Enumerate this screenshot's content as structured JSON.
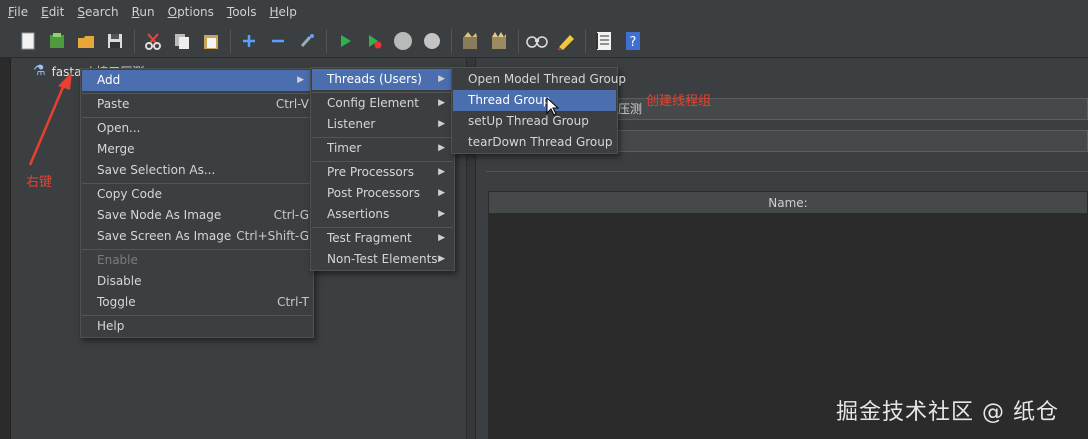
{
  "menubar": [
    "File",
    "Edit",
    "Search",
    "Run",
    "Options",
    "Tools",
    "Help"
  ],
  "toolbar_icons": [
    "new-icon",
    "templates-icon",
    "open-icon",
    "save-icon",
    "cut-icon",
    "copy-icon",
    "paste-icon",
    "expand-icon",
    "collapse-icon",
    "toggle-icon",
    "start-icon",
    "start-no-pause-icon",
    "stop-icon",
    "shutdown-icon",
    "clear-icon",
    "clear-all-icon",
    "search-icon",
    "reset-search-icon",
    "function-helper-icon",
    "help-icon"
  ],
  "tree": {
    "root_label": "fastapi 接口压测"
  },
  "right_panel": {
    "name_value": "压测",
    "table_header": "Name:"
  },
  "context_menu": {
    "items": [
      {
        "label": "Add",
        "shortcut": "",
        "submenu": true,
        "selected": true
      },
      {
        "label": "Paste",
        "shortcut": "Ctrl-V"
      },
      {
        "label": "Open..."
      },
      {
        "label": "Merge"
      },
      {
        "label": "Save Selection As..."
      },
      {
        "label": "Copy Code"
      },
      {
        "label": "Save Node As Image",
        "shortcut": "Ctrl-G"
      },
      {
        "label": "Save Screen As Image",
        "shortcut": "Ctrl+Shift-G"
      },
      {
        "label": "Enable",
        "disabled": true
      },
      {
        "label": "Disable"
      },
      {
        "label": "Toggle",
        "shortcut": "Ctrl-T"
      },
      {
        "label": "Help"
      }
    ]
  },
  "add_menu": {
    "items": [
      "Threads (Users)",
      "Config Element",
      "Listener",
      "Timer",
      "Pre Processors",
      "Post Processors",
      "Assertions",
      "Test Fragment",
      "Non-Test Elements"
    ]
  },
  "threads_menu": {
    "items": [
      "Open Model Thread Group",
      "Thread Group",
      "setUp Thread Group",
      "tearDown Thread Group"
    ]
  },
  "annotations": {
    "right_click": "右键",
    "create_thread_group": "创建线程组"
  },
  "watermark": "掘金技术社区 @ 纸仓",
  "colors": {
    "selection": "#4b6eaf",
    "annotation": "#e8402f",
    "background": "#3c3f41"
  }
}
